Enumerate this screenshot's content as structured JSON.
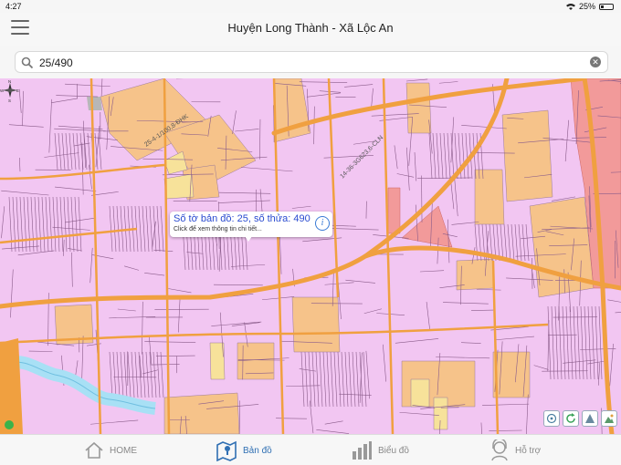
{
  "status_bar": {
    "time": "4:27",
    "battery": "25%",
    "battery_level": 0.25
  },
  "header": {
    "title": "Huyện Long Thành - Xã Lộc An"
  },
  "search": {
    "value": "25/490",
    "placeholder": ""
  },
  "map": {
    "labels": [
      "25-4-1/100,8-ĐHK",
      "14-36-3G623,6-CLN"
    ],
    "popup": {
      "title": "Số tờ bản đồ: 25, số thửa: 490",
      "subtitle": "Click để xem thông tin chi tiết..."
    }
  },
  "tabs": [
    {
      "label": "HOME",
      "icon": "home-icon",
      "active": false
    },
    {
      "label": "Bản đồ",
      "icon": "map-icon",
      "active": true
    },
    {
      "label": "Biểu đồ",
      "icon": "bar-chart-icon",
      "active": false
    },
    {
      "label": "Hỗ trợ",
      "icon": "support-icon",
      "active": false
    }
  ],
  "colors": {
    "parcel": "#f2c6f2",
    "road": "#f0a040",
    "orange_parcel": "#f6c38a",
    "accent": "#2f6fb3",
    "water": "#a8e0f5",
    "red_zone": "#f29a9a"
  }
}
